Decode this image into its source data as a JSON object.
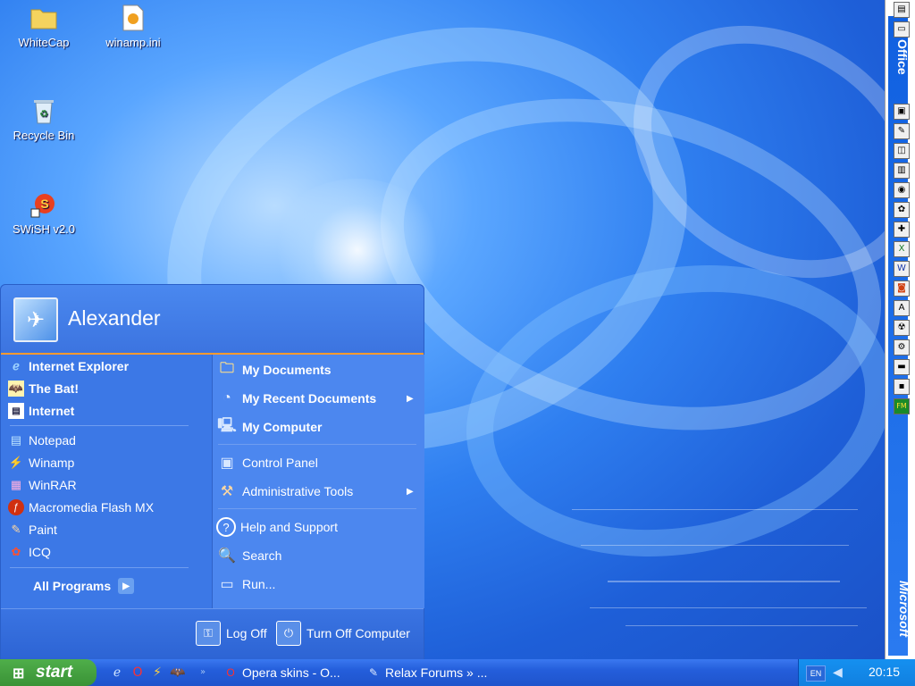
{
  "desktop": {
    "icons": [
      {
        "label": "WhiteCap",
        "icon": "folder-icon"
      },
      {
        "label": "winamp.ini",
        "icon": "config-file-icon"
      },
      {
        "label": "Recycle Bin",
        "icon": "recycle-bin-icon"
      },
      {
        "label": "SWiSH v2.0",
        "icon": "swish-shortcut-icon"
      }
    ]
  },
  "right_bar": {
    "office_label": "Office",
    "vendor_label": "Microsoft"
  },
  "start_menu": {
    "user_name": "Alexander",
    "pinned": [
      {
        "label": "Internet Explorer",
        "icon": "internet-explorer-icon"
      },
      {
        "label": "The Bat!",
        "icon": "the-bat-icon"
      },
      {
        "label": "Internet",
        "icon": "internet-icon"
      }
    ],
    "recent": [
      {
        "label": "Notepad",
        "icon": "notepad-icon"
      },
      {
        "label": "Winamp",
        "icon": "winamp-icon"
      },
      {
        "label": "WinRAR",
        "icon": "winrar-icon"
      },
      {
        "label": "Macromedia Flash MX",
        "icon": "flash-icon"
      },
      {
        "label": "Paint",
        "icon": "paint-icon"
      },
      {
        "label": "ICQ",
        "icon": "icq-icon"
      }
    ],
    "all_programs": "All Programs",
    "places": [
      {
        "label": "My Documents",
        "icon": "my-documents-icon"
      },
      {
        "label": "My Recent Documents",
        "icon": "recent-documents-icon"
      },
      {
        "label": "My Computer",
        "icon": "my-computer-icon"
      }
    ],
    "settings": [
      {
        "label": "Control Panel",
        "icon": "control-panel-icon"
      },
      {
        "label": "Administrative Tools",
        "icon": "admin-tools-icon"
      }
    ],
    "help": [
      {
        "label": "Help and Support",
        "icon": "help-icon"
      },
      {
        "label": "Search",
        "icon": "search-icon"
      },
      {
        "label": "Run...",
        "icon": "run-icon"
      }
    ],
    "log_off": "Log Off",
    "turn_off": "Turn Off Computer"
  },
  "taskbar": {
    "start_label": "start",
    "tasks": [
      {
        "label": "Opera skins - O...",
        "icon": "opera-icon"
      },
      {
        "label": "Relax Forums » ...",
        "icon": "notepad-icon"
      }
    ],
    "language": "EN",
    "clock": "20:15"
  }
}
